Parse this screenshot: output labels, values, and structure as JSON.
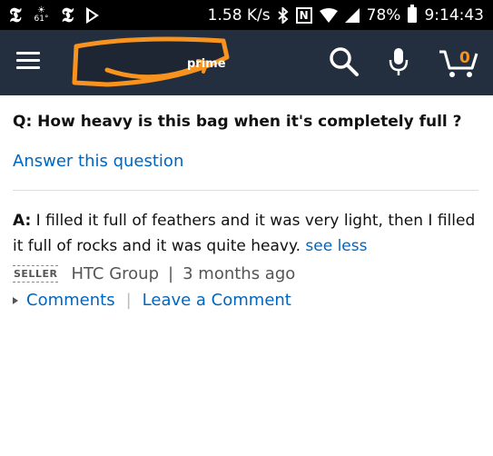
{
  "status_bar": {
    "weather_temp": "61°",
    "network_speed": "1.58 K/s",
    "nfc_letter": "N",
    "battery_percent": "78%",
    "time": "9:14:43"
  },
  "header": {
    "prime_label": "prime",
    "cart_count": "0",
    "colors": {
      "background": "#232f3e",
      "accent": "#f7931e"
    },
    "icons": [
      "menu-icon",
      "amazon-logo",
      "search-icon",
      "microphone-icon",
      "cart-icon"
    ]
  },
  "qa": {
    "question": "Q: How heavy is this bag when it's completely full ?",
    "answer_link": "Answer this question",
    "answer_label": "A:",
    "answer_text": " I filled it full of feathers and it was very light, then I filled it full of rocks and it was quite heavy. ",
    "see_less": "see less",
    "seller_badge": "SELLER",
    "author": "HTC Group",
    "meta_separator": "|",
    "time_ago": "3 months ago",
    "comments_link": "Comments",
    "leave_comment_link": "Leave a Comment",
    "link_color": "#0066c0"
  }
}
